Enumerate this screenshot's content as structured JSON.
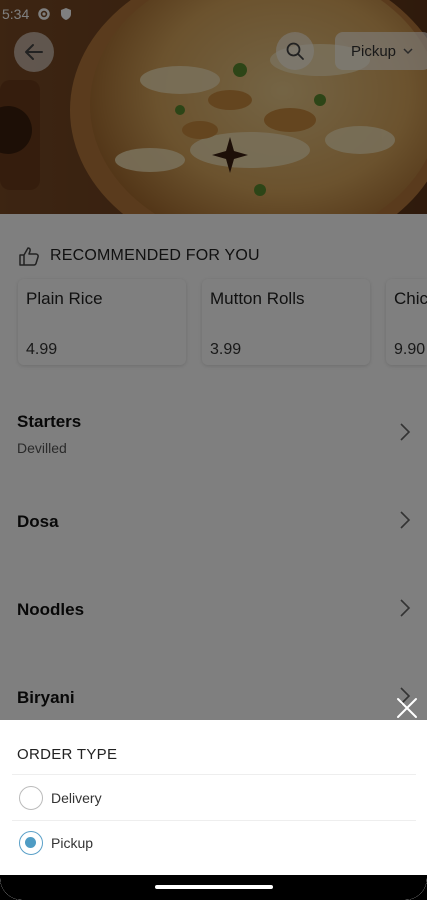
{
  "status_bar": {
    "time": "5:34",
    "icons": [
      "gear-icon",
      "shield-icon"
    ]
  },
  "header": {
    "back_icon": "arrow-left-icon",
    "search_icon": "search-icon",
    "order_mode_button": "Pickup",
    "order_mode_icon": "chevron-down-icon"
  },
  "recommended": {
    "title": "RECOMMENDED FOR YOU",
    "icon": "thumbs-up-icon",
    "items": [
      {
        "name": "Plain Rice",
        "price": "4.99"
      },
      {
        "name": "Mutton Rolls",
        "price": "3.99"
      },
      {
        "name": "Chic",
        "price": "9.90"
      }
    ]
  },
  "categories": [
    {
      "title": "Starters",
      "subtitle": "Devilled"
    },
    {
      "title": "Dosa",
      "subtitle": ""
    },
    {
      "title": "Noodles",
      "subtitle": ""
    },
    {
      "title": "Biryani",
      "subtitle": ""
    }
  ],
  "order_type_sheet": {
    "title": "ORDER TYPE",
    "options": [
      {
        "label": "Delivery",
        "selected": false
      },
      {
        "label": "Pickup",
        "selected": true
      }
    ],
    "accent_color": "#4f9cc4"
  }
}
